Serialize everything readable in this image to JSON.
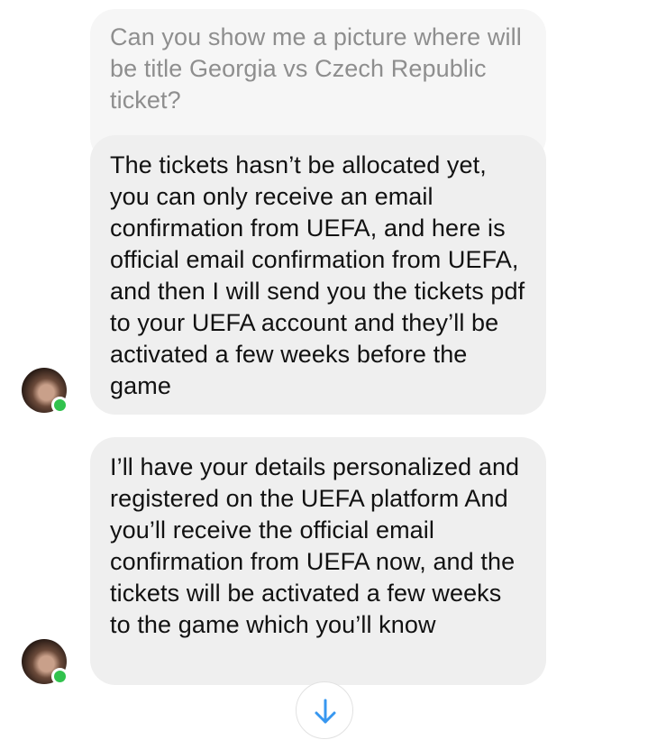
{
  "conversation": {
    "quoted_message": "Can you show me a picture where will be title Georgia vs Czech Republic ticket?",
    "messages": [
      {
        "text": "The tickets hasn’t be allocated yet, you can only receive an email confirmation from UEFA, and here is official email confirmation from UEFA, and then I will send you the tickets pdf to your UEFA account and they’ll be activated a few weeks before the game"
      },
      {
        "text": "I’ll have your details personalized and registered on the UEFA platform And you’ll receive the official email confirmation from UEFA now, and the tickets will be activated a few weeks to the game which you’ll know"
      }
    ],
    "avatar_status": "online",
    "colors": {
      "bubble": "#efefef",
      "quoted_text": "#8e8e8e",
      "online_dot": "#31c24d",
      "accent": "#3797f0"
    }
  },
  "icons": {
    "scroll_down": "arrow-down-icon"
  }
}
